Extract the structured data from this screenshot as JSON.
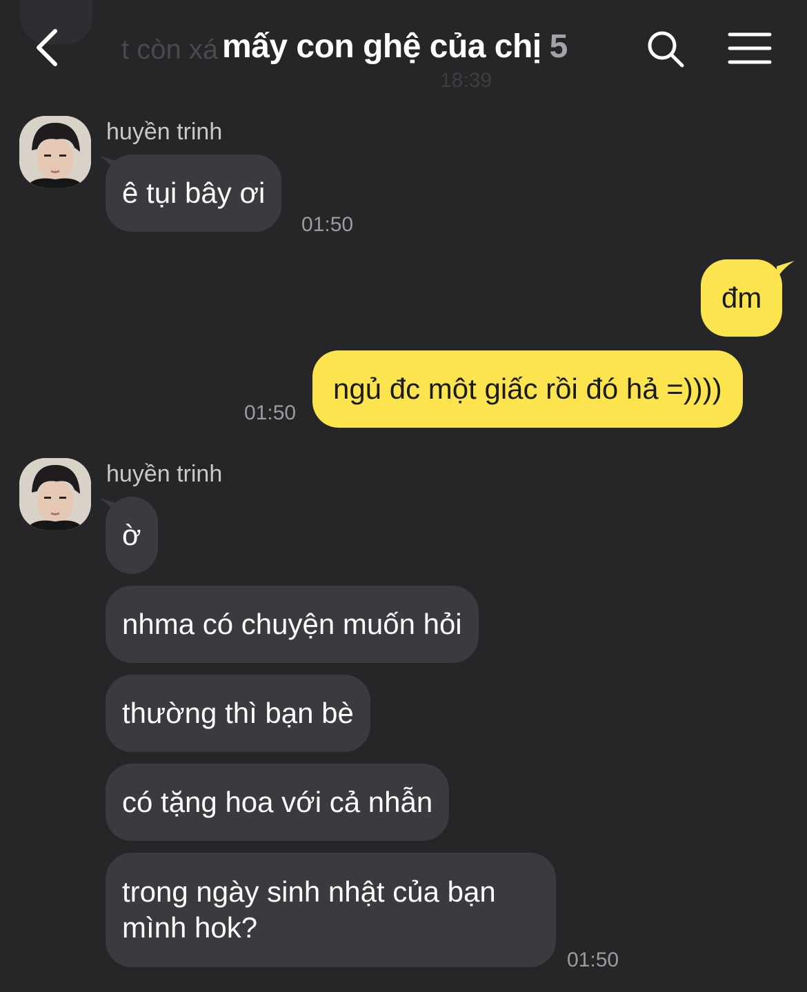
{
  "header": {
    "title": "mấy con ghệ của chị",
    "member_count": "5",
    "back_icon": "chevron-left-icon",
    "search_icon": "search-icon",
    "menu_icon": "hamburger-menu-icon",
    "ghost_preview_text": "t còn xá",
    "ghost_preview_time": "18:39"
  },
  "messages": {
    "group1": {
      "sender": "huyền trinh",
      "bubbles": [
        "ê tụi bây ơi"
      ],
      "time": "01:50"
    },
    "group2": {
      "bubbles": [
        "đm",
        "ngủ đc một giấc rồi đó hả =))))"
      ],
      "time": "01:50"
    },
    "group3": {
      "sender": "huyền trinh",
      "bubbles": [
        "ờ",
        "nhma có chuyện muốn hỏi",
        "thường thì bạn bè",
        "có tặng hoa với cả nhẫn"
      ],
      "last_line1": "trong ngày sinh nhật của bạn",
      "last_line2": "mình hok?",
      "time": "01:50"
    }
  },
  "colors": {
    "background": "#262629",
    "incoming_bubble": "#3b3b3f",
    "outgoing_bubble": "#fbe44e"
  }
}
